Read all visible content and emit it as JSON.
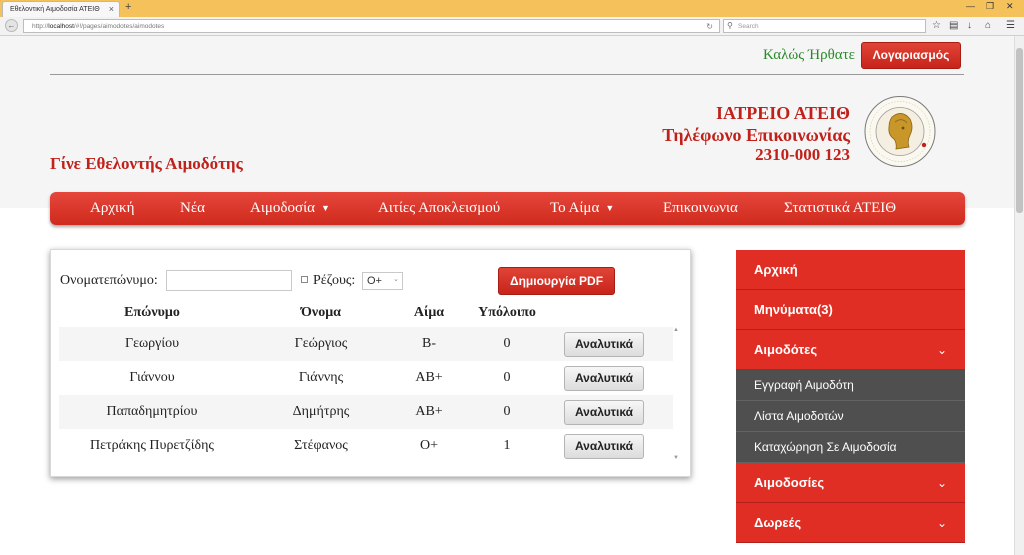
{
  "browser": {
    "tab_title": "Εθελοντική Αιμοδοσία ΑΤΕΙΘ",
    "tab_close": "×",
    "new_tab": "+",
    "url_scheme": "http://",
    "url_host": "localhost",
    "url_path": "/#!/pages/aimodotes/aimodotes",
    "search_placeholder": "Search"
  },
  "header": {
    "welcome": "Καλώς Ήρθατε",
    "account_button": "Λογαριασμός",
    "clinic_name": "ΙΑΤΡΕΙΟ ΑΤΕΙΘ",
    "phone_label": "Τηλέφωνο Επικοινωνίας",
    "phone_number": "2310-000 123",
    "volunteer_link": "Γίνε Εθελοντής Αιμοδότης"
  },
  "nav": {
    "items": [
      {
        "label": "Αρχική"
      },
      {
        "label": "Νέα"
      },
      {
        "label": "Αιμοδοσία"
      },
      {
        "label": "Αιτίες Αποκλεισμού"
      },
      {
        "label": "Το Αίμα"
      },
      {
        "label": "Επικοινωνια"
      },
      {
        "label": "Στατιστικά ΑΤΕΙΘ"
      }
    ],
    "caret": "▼"
  },
  "filters": {
    "name_label": "Ονοματεπώνυμο:",
    "name_value": "",
    "rhesus_label": "Ρέζους:",
    "blood_select": "O+",
    "pdf_button": "Δημιουργία PDF"
  },
  "table": {
    "columns": [
      "Επώνυμο",
      "Όνομα",
      "Αίμα",
      "Υπόλοιπο"
    ],
    "rows": [
      {
        "surname": "Γεωργίου",
        "name": "Γεώργιος",
        "blood": "B-",
        "balance": "0",
        "action": "Αναλυτικά"
      },
      {
        "surname": "Γιάννου",
        "name": "Γιάννης",
        "blood": "AB+",
        "balance": "0",
        "action": "Αναλυτικά"
      },
      {
        "surname": "Παπαδημητρίου",
        "name": "Δημήτρης",
        "blood": "AB+",
        "balance": "0",
        "action": "Αναλυτικά"
      },
      {
        "surname": "Πετράκης Πυρετζίδης",
        "name": "Στέφανος",
        "blood": "O+",
        "balance": "1",
        "action": "Αναλυτικά"
      }
    ]
  },
  "sidebar": {
    "home": "Αρχική",
    "messages": "Μηνύματα(3)",
    "donors": "Αιμοδότες",
    "donors_sub": [
      "Εγγραφή Αιμοδότη",
      "Λίστα Αιμοδοτών",
      "Καταχώρηση Σε Αιμοδοσία"
    ],
    "donations": "Αιμοδοσίες",
    "gifts": "Δωρεές"
  },
  "colors": {
    "brand_red": "#e02e24",
    "header_red": "#c0221b",
    "welcome_green": "#2a8a2a",
    "submenu_gray": "#4f4f4f"
  },
  "icons": {
    "back": "back-arrow-icon",
    "reload": "reload-icon",
    "search": "search-icon",
    "bookmark": "star-icon",
    "downloads": "download-icon",
    "home": "home-icon",
    "menu": "hamburger-menu-icon",
    "chevron": "chevron-down-icon"
  }
}
